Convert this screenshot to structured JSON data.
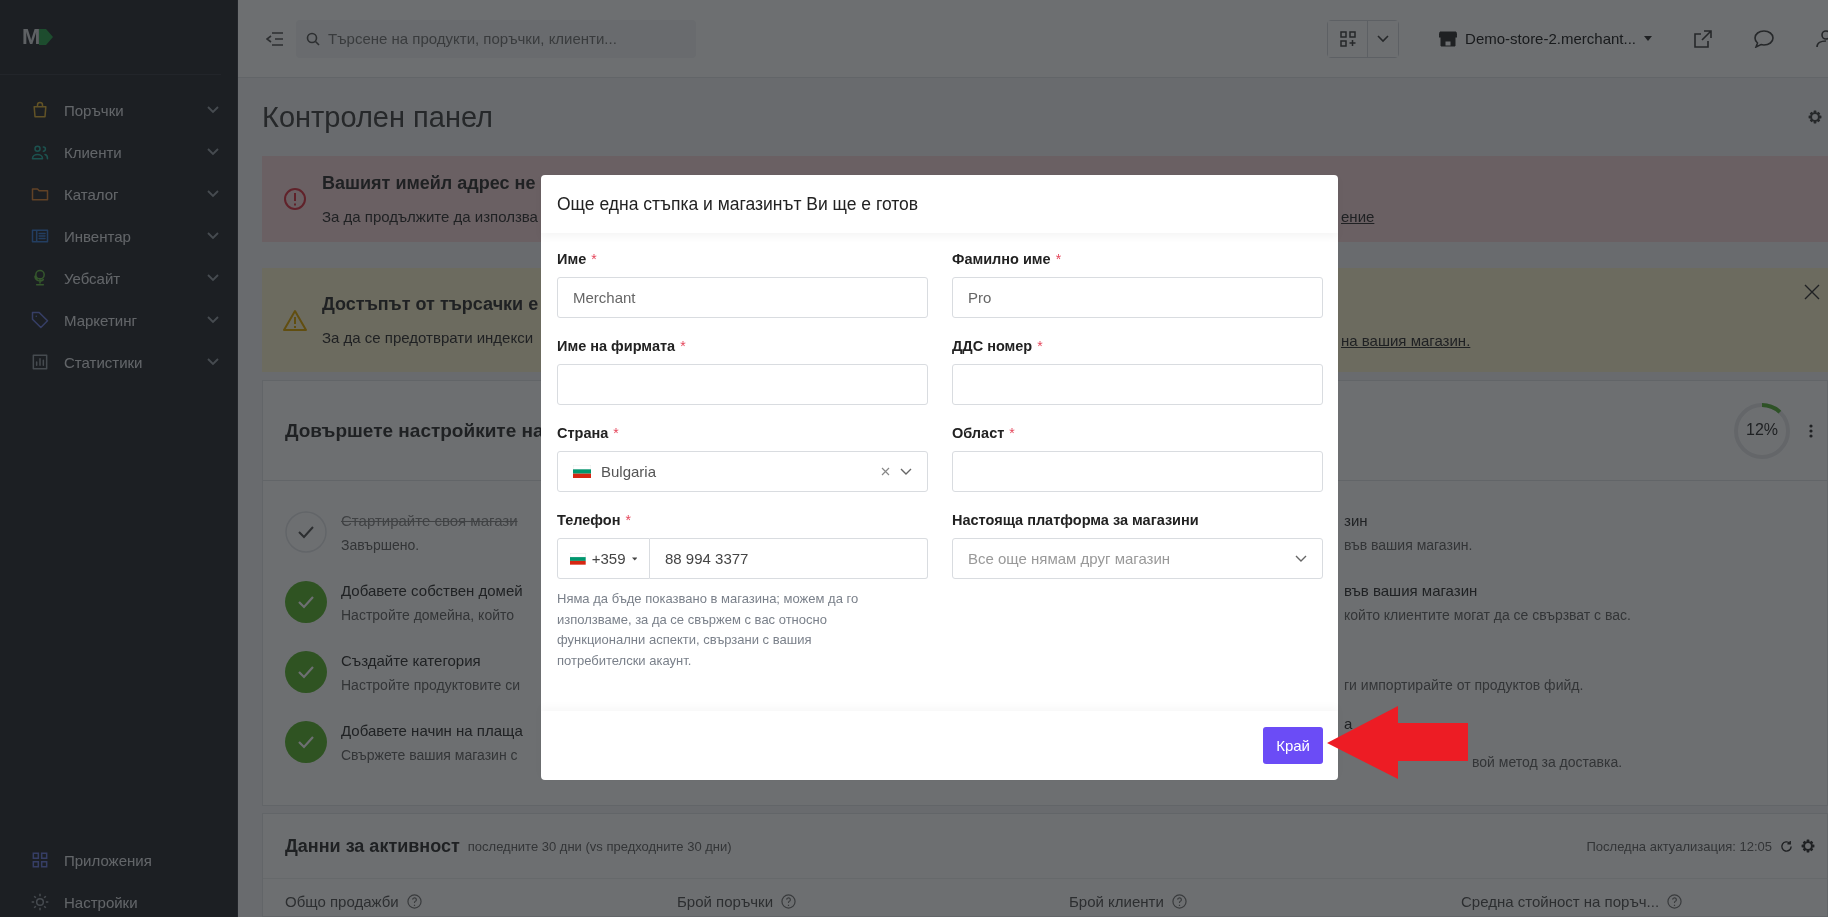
{
  "sidebar": {
    "logo": "M",
    "items": [
      {
        "label": "Поръчки"
      },
      {
        "label": "Клиенти"
      },
      {
        "label": "Каталог"
      },
      {
        "label": "Инвентар"
      },
      {
        "label": "Уебсайт"
      },
      {
        "label": "Маркетинг"
      },
      {
        "label": "Статистики"
      }
    ],
    "bottom_items": [
      {
        "label": "Приложения"
      },
      {
        "label": "Настройки"
      }
    ]
  },
  "topbar": {
    "search": {
      "placeholder": "Търсене на продукти, поръчки, клиенти..."
    },
    "store": "Demo-store-2.merchant..."
  },
  "page_title": "Контролен панел",
  "alerts": [
    {
      "kind": "error",
      "title": "Вашият имейл адрес не",
      "text": "За да продължите да използва",
      "link": "ение",
      "closable": false
    },
    {
      "kind": "warning",
      "title": "Достъпът от търсачки е",
      "text": "За да се предотврати индекси",
      "link": "на вашия магазин.",
      "closable": true
    }
  ],
  "setup": {
    "title": "Довършете настройките на",
    "progress": "12%",
    "level": 0.12,
    "steps": [
      {
        "kind": "finished",
        "title": "Стартирайте своя магази",
        "text": "Завършено."
      },
      {
        "kind": "checked",
        "title": "Добавете собствен домей",
        "text": "Настройте домейна, който"
      },
      {
        "kind": "checked",
        "title": "Създайте категория",
        "text": "Настройте продуктовите си"
      },
      {
        "kind": "checked",
        "title": "Добавете начин на плаща",
        "text": "Свържете вашия магазин с"
      }
    ],
    "steps_right": [
      {
        "title": "зин",
        "text": "във вашия магазин."
      },
      {
        "title": "във вашия магазин",
        "text": "който клиентите могат да се свързват с вас."
      },
      {
        "text": "ги импортирайте от продуктов фийд."
      },
      {
        "title": "а",
        "text": "вой метод за доставка."
      }
    ]
  },
  "activity": {
    "title": "Данни за активност",
    "subtitle": "последните 30 дни (vs предходните 30 дни)",
    "updated": "Последна актуализация: 12:05",
    "metrics": [
      "Общо продажби",
      "Брой поръчки",
      "Брой клиенти",
      "Средна стойност на поръч..."
    ]
  },
  "modal": {
    "title": "Още една стъпка и магазинът Ви ще е готов",
    "fields": [
      {
        "kind": "text",
        "label": "Име",
        "mark": "*",
        "value": "Merchant"
      },
      {
        "kind": "text",
        "label": "Фамилно име",
        "mark": "*",
        "value": "Pro"
      },
      {
        "kind": "text",
        "label": "Име на фирмата",
        "mark": "*"
      },
      {
        "kind": "text",
        "label": "ДДС номер",
        "mark": "*"
      },
      {
        "kind": "country",
        "label": "Страна",
        "mark": "*",
        "value": "Bulgaria"
      },
      {
        "kind": "text",
        "label": "Област",
        "mark": "*"
      },
      {
        "kind": "phone",
        "label": "Телефон",
        "mark": "*",
        "dial_code": "+359",
        "value": "88 994 3377",
        "hint": "Няма да бъде показвано в магазина; можем да го използваме, за да се свържем с вас относно функционални аспекти, свързани с вашия потребителски акаунт."
      },
      {
        "kind": "select",
        "label": "Настояща платформа за магазини",
        "placeholder": "Все още нямам друг магазин"
      }
    ],
    "submit": "Край"
  }
}
